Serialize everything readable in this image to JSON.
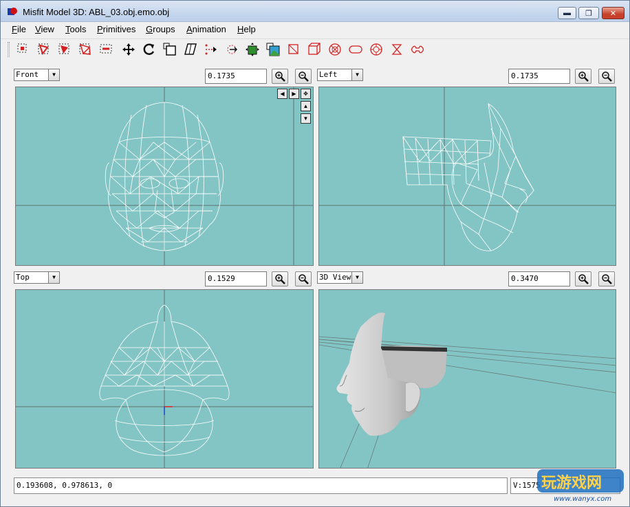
{
  "window": {
    "title": "Misfit Model 3D: ABL_03.obj.emo.obj",
    "minimize": "▬",
    "maximize": "❐",
    "close": "✕"
  },
  "menu": [
    {
      "underline": "F",
      "rest": "ile"
    },
    {
      "underline": "V",
      "rest": "iew"
    },
    {
      "underline": "T",
      "rest": "ools"
    },
    {
      "underline": "P",
      "rest": "rimitives"
    },
    {
      "underline": "G",
      "rest": "roups"
    },
    {
      "underline": "A",
      "rest": "nimation"
    },
    {
      "underline": "H",
      "rest": "elp"
    }
  ],
  "toolbar": {
    "tools": [
      "select-vertices-icon",
      "select-faces-icon",
      "select-connected-icon",
      "select-groups-icon",
      "select-bones-icon",
      "move-icon",
      "rotate-icon",
      "scale-icon",
      "shear-icon",
      "extrude-icon",
      "attract-icon",
      "drag-vertex-icon",
      "texture-icon",
      "new-vertex-icon",
      "new-triangle-icon",
      "new-cube-icon",
      "new-sphere-icon",
      "new-cylinder-icon",
      "new-torus-icon",
      "new-point-icon",
      "new-joint-icon"
    ],
    "accent": "#d62020"
  },
  "viewports": {
    "front": {
      "label": "Front",
      "zoom": "0.1735"
    },
    "left": {
      "label": "Left",
      "zoom": "0.1735"
    },
    "top": {
      "label": "Top",
      "zoom": "0.1529"
    },
    "view3d": {
      "label": "3D View",
      "zoom": "0.3470"
    }
  },
  "nav": {
    "left": "◀",
    "right": "▶",
    "pan": "✥",
    "up": "▲",
    "down": "▼"
  },
  "status": {
    "coords": "0.193608, 0.978613, 0",
    "counts": "V:1575"
  },
  "watermark": {
    "text": "玩游戏网",
    "url": "www.wanyx.com"
  },
  "colors": {
    "viewport_bg": "#83c5c4",
    "wire": "#ffffff",
    "grid": "#5f6f6f"
  }
}
